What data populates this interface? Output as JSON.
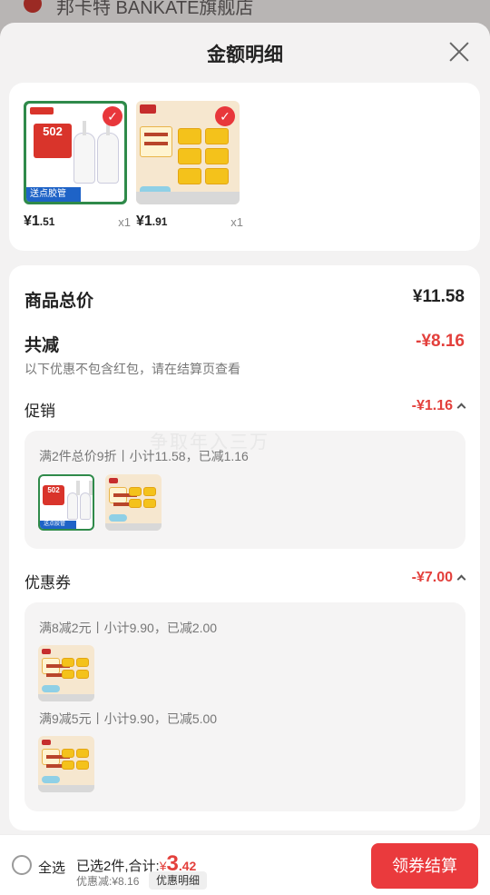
{
  "background": {
    "store_name": "邦卡特 BANKATE旗舰店"
  },
  "sheet": {
    "title": "金额明细"
  },
  "products": [
    {
      "price_int": "¥1",
      "price_dec": ".51",
      "qty": "x1",
      "icon": "glue-product-image",
      "thumb_label": "502",
      "thumb_band": "送点胶管"
    },
    {
      "price_int": "¥1",
      "price_dec": ".91",
      "qty": "x1",
      "icon": "soap-product-image"
    }
  ],
  "summary": {
    "total_label": "商品总价",
    "total_value": "¥11.58",
    "reduce_label": "共减",
    "reduce_value": "-¥8.16",
    "note": "以下优惠不包含红包，请在结算页查看"
  },
  "promotion": {
    "label": "促销",
    "value": "-¥1.16",
    "rule": "满2件总价9折丨小计11.58，已减1.16"
  },
  "coupon": {
    "label": "优惠券",
    "value": "-¥7.00",
    "rules": [
      "满8减2元丨小计9.90，已减2.00",
      "满9减5元丨小计9.90，已减5.00"
    ]
  },
  "watermark": "争取年入三万",
  "bottom": {
    "select_all": "全选",
    "selected_text": "已选2件,合计:",
    "total_currency": "¥",
    "total_int": "3",
    "total_dec": ".42",
    "discount_text": "优惠减:¥8.16",
    "detail_label": "优惠明细",
    "checkout_label": "领券结算"
  },
  "colors": {
    "accent": "#e3403c",
    "button": "#ea3a3d"
  }
}
